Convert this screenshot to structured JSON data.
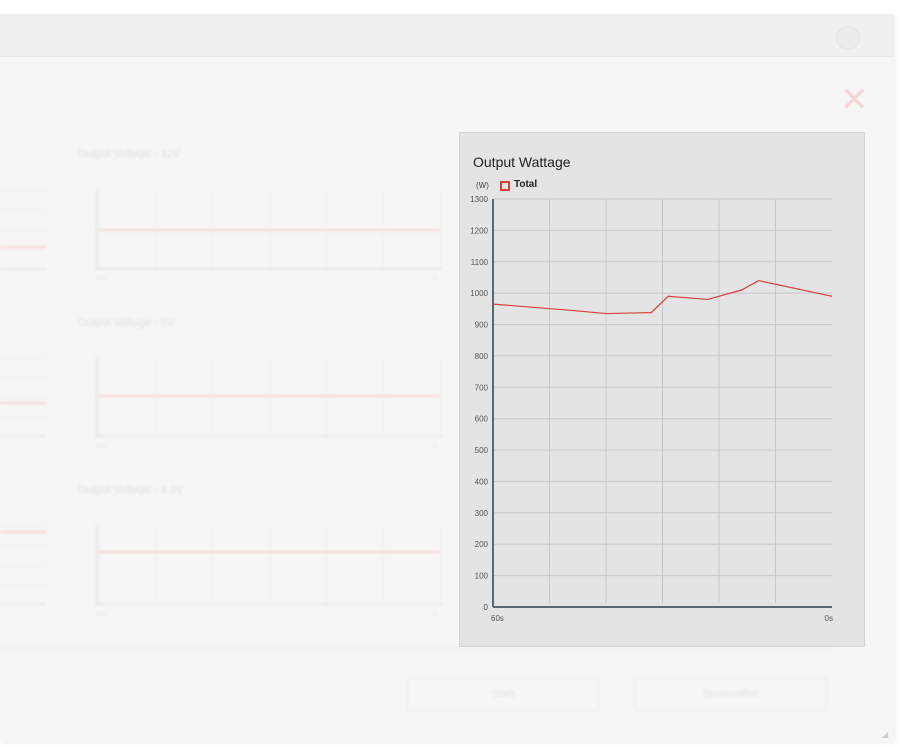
{
  "background_window": {
    "mini_charts": [
      {
        "title": "Output Voltage - 12V",
        "x_start": "60s",
        "x_end": "0s"
      },
      {
        "title": "Output Voltage - 5V",
        "x_start": "60s",
        "x_end": "0s"
      },
      {
        "title": "Output Voltage - 3.3V",
        "x_start": "60s",
        "x_end": "0s"
      }
    ],
    "buttons": {
      "start": "Start",
      "screenshot": "Screenshot"
    }
  },
  "panel": {
    "title": "Output Wattage",
    "unit": "(W)",
    "legend": "Total"
  },
  "colors": {
    "series": "#d9403a",
    "panel_bg": "#e4e4e4",
    "grid": "#c8c8c8"
  },
  "chart_data": {
    "type": "line",
    "title": "Output Wattage",
    "ylabel": "(W)",
    "xlabel": "",
    "x_tick_labels": [
      "60s",
      "0s"
    ],
    "xlim": [
      60,
      0
    ],
    "ylim": [
      0,
      1300
    ],
    "y_ticks": [
      0,
      100,
      200,
      300,
      400,
      500,
      600,
      700,
      800,
      900,
      1000,
      1100,
      1200,
      1300
    ],
    "grid": true,
    "legend_position": "top-left",
    "series": [
      {
        "name": "Total",
        "x": [
          60,
          46,
          40,
          32,
          29,
          22,
          16,
          13,
          0
        ],
        "y": [
          965,
          945,
          935,
          938,
          990,
          980,
          1010,
          1040,
          990
        ]
      }
    ]
  }
}
